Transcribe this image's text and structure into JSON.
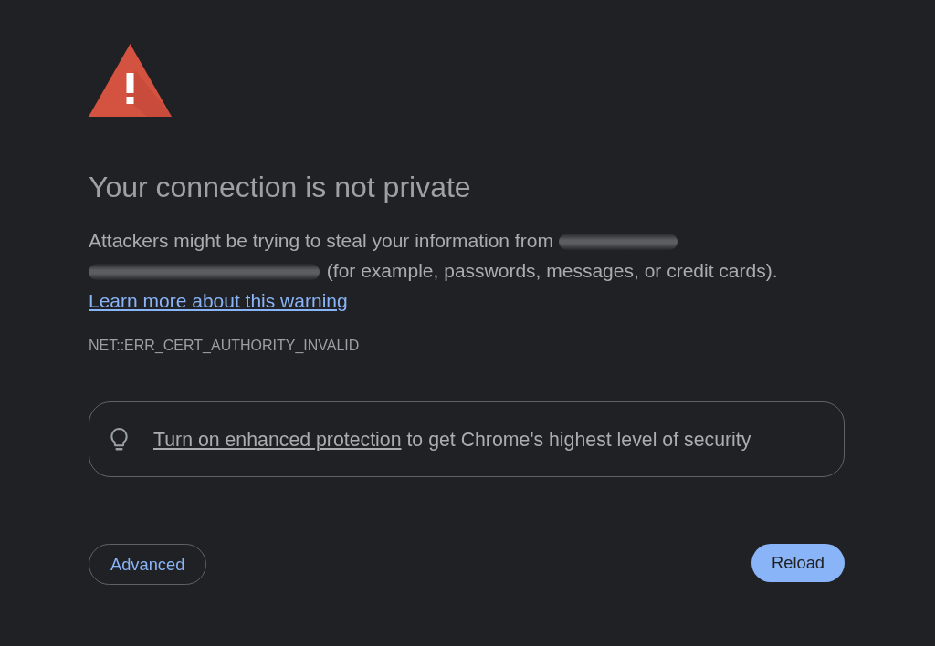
{
  "heading": "Your connection is not private",
  "message": {
    "text_before": "Attackers might be trying to steal your information from",
    "host_blurred": true,
    "text_after": "(for example, passwords, messages, or credit cards).",
    "link": "Learn more about this warning"
  },
  "error_code": "NET::ERR_CERT_AUTHORITY_INVALID",
  "protection_banner": {
    "link": "Turn on enhanced protection",
    "text": "to get Chrome's highest level of security"
  },
  "buttons": [
    {
      "label": "Advanced",
      "kind": "outline"
    },
    {
      "label": "Reload",
      "kind": "primary"
    }
  ]
}
